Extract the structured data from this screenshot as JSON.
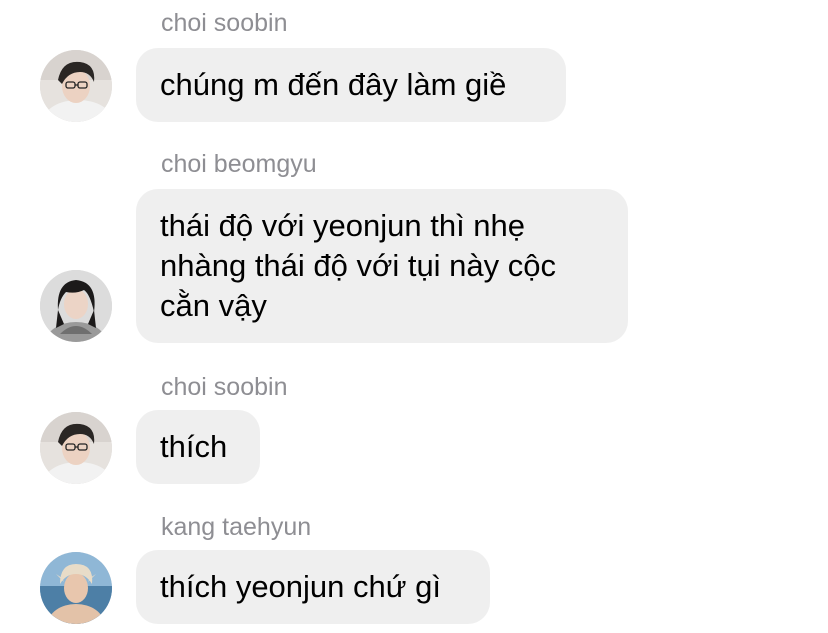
{
  "messages": [
    {
      "sender": "choi soobin",
      "avatar_icon": "avatar-soobin",
      "lines": [
        "chúng m đến đây làm giề"
      ]
    },
    {
      "sender": "choi beomgyu",
      "avatar_icon": "avatar-beomgyu",
      "lines": [
        "thái độ với yeonjun thì nhẹ",
        "nhàng thái độ với tụi này cộc",
        "cằn vậy"
      ]
    },
    {
      "sender": "choi soobin",
      "avatar_icon": "avatar-soobin",
      "lines": [
        "thích"
      ]
    },
    {
      "sender": "kang taehyun",
      "avatar_icon": "avatar-taehyun",
      "lines": [
        "thích yeonjun chứ gì"
      ]
    }
  ],
  "colors": {
    "bubble_bg": "#efefef",
    "sender_text": "#8e8e93",
    "message_text": "#000000",
    "background": "#ffffff"
  }
}
